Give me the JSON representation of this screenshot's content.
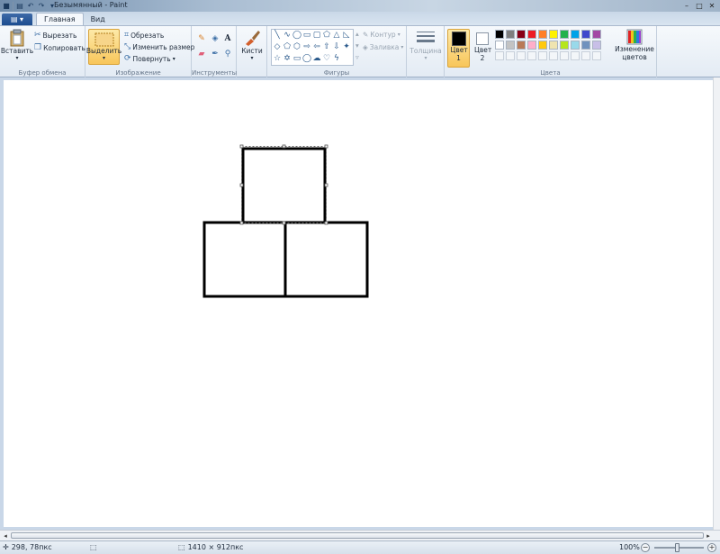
{
  "window": {
    "title": "Безымянный - Paint"
  },
  "tabs": {
    "menu_icon": "paint-menu-icon",
    "home": "Главная",
    "view": "Вид"
  },
  "ribbon": {
    "clipboard": {
      "paste": "Вставить",
      "cut": "Вырезать",
      "copy": "Копировать",
      "label": "Буфер обмена"
    },
    "image": {
      "select": "Выделить",
      "crop": "Обрезать",
      "resize": "Изменить размер",
      "rotate": "Повернуть",
      "label": "Изображение"
    },
    "tools": {
      "label": "Инструменты"
    },
    "brushes": {
      "label": "Кисти"
    },
    "shapes": {
      "outline": "Контур",
      "fill": "Заливка",
      "label": "Фигуры"
    },
    "size": {
      "label": "Толщина"
    },
    "colors": {
      "color1": "Цвет 1",
      "color2": "Цвет 2",
      "edit": "Изменение цветов",
      "label": "Цвета",
      "color1_value": "#000000",
      "color2_value": "#ffffff",
      "palette": [
        "#000000",
        "#7f7f7f",
        "#880015",
        "#ed1c24",
        "#ff7f27",
        "#fff200",
        "#22b14c",
        "#00a2e8",
        "#3f48cc",
        "#a349a4",
        "#ffffff",
        "#c3c3c3",
        "#b97a57",
        "#ffaec9",
        "#ffc90e",
        "#efe4b0",
        "#b5e61d",
        "#99d9ea",
        "#7092be",
        "#c8bfe7"
      ]
    }
  },
  "status": {
    "cursor_pos": "298, 78пкс",
    "image_size": "1410 × 912пкс",
    "zoom": "100%"
  }
}
